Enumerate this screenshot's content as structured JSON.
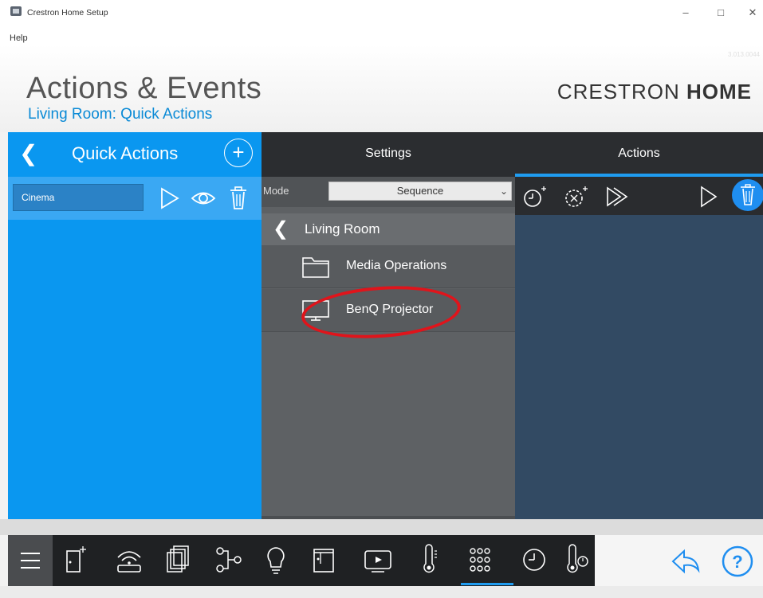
{
  "window": {
    "title": "Crestron Home Setup",
    "menu": [
      "Help"
    ]
  },
  "header": {
    "title": "Actions & Events",
    "subtitle": "Living Room: Quick Actions",
    "brand_light": "CRESTRON",
    "brand_bold": "HOME",
    "version": "3.013.0044"
  },
  "quick_actions_panel": {
    "title": "Quick Actions",
    "items": [
      {
        "name": "Cinema"
      }
    ]
  },
  "settings_panel": {
    "tab_label": "Settings",
    "mode_label": "Mode",
    "mode_value": "Sequence",
    "breadcrumb": "Living Room",
    "items": [
      {
        "label": "Media Operations",
        "icon": "folder-icon"
      },
      {
        "label": "BenQ Projector",
        "icon": "display-icon"
      }
    ]
  },
  "actions_panel": {
    "tab_label": "Actions"
  },
  "bottom_nav": {
    "active": "keypad",
    "items": [
      "menu",
      "rooms",
      "network",
      "pages",
      "scenes",
      "lighting",
      "shades",
      "media",
      "climate",
      "keypad",
      "schedule",
      "sensors"
    ]
  },
  "colors": {
    "accent_blue": "#0a97f0",
    "dark": "#2b2d30",
    "highlight_red": "#e0141b"
  }
}
